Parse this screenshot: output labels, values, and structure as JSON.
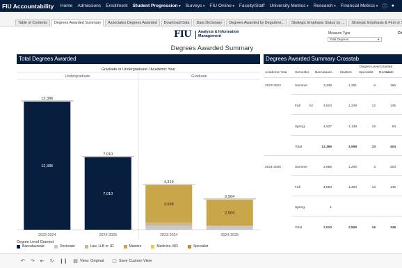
{
  "nav": {
    "brand": "FIU Accountability",
    "items": [
      {
        "label": "Home",
        "active": false,
        "dropdown": false
      },
      {
        "label": "Admissions",
        "active": false,
        "dropdown": false
      },
      {
        "label": "Enrollment",
        "active": false,
        "dropdown": false
      },
      {
        "label": "Student Progression",
        "active": true,
        "dropdown": true
      },
      {
        "label": "Surveys",
        "active": false,
        "dropdown": true
      },
      {
        "label": "FIU Online",
        "active": false,
        "dropdown": true
      },
      {
        "label": "Faculty/Staff",
        "active": false,
        "dropdown": false
      },
      {
        "label": "University Metrics",
        "active": false,
        "dropdown": true
      },
      {
        "label": "Research",
        "active": false,
        "dropdown": true
      },
      {
        "label": "Financial Metrics",
        "active": false,
        "dropdown": true
      }
    ],
    "caret": "▾",
    "help_icon": "help-circle-icon",
    "user_icon": "user-icon"
  },
  "tabs": [
    "Table of Contents",
    "Degrees Awarded Summary",
    "Associates Degrees Awarded",
    "Download Data",
    "Data Dictionary",
    "Degrees Awarded by Departme...",
    "Strategic Emphasis Status by ...",
    "Strategic Emphasis & First or Se..."
  ],
  "active_tab": 1,
  "header": {
    "logo_text": "FIU",
    "logo_sub1": "Analysis & Information",
    "logo_sub2": "Management",
    "title": "Degrees Awarded Summary",
    "measure_label": "Measure Type",
    "measure_value": "Total Degrees",
    "ch_label": "Ch"
  },
  "left_panel": {
    "title": "Total Degrees Awarded"
  },
  "chart_data": {
    "type": "bar",
    "stacked": true,
    "column_header": "Graduate or Undergraduate / Academic Year",
    "groups": [
      "Undergraduate",
      "Graduate"
    ],
    "categories": [
      "2023-2024",
      "2024-2025",
      "2023-2024",
      "2024-2025"
    ],
    "category_group": [
      "Undergraduate",
      "Undergraduate",
      "Graduate",
      "Graduate"
    ],
    "series": [
      {
        "name": "Baccalaureate",
        "color": "#081e3f",
        "values": [
          12386,
          7010,
          0,
          0
        ]
      },
      {
        "name": "Doctorate",
        "color": "#c8c8c8",
        "values": [
          0,
          0,
          404,
          348
        ]
      },
      {
        "name": "Law, LLB or JD",
        "color": "#cbb98a",
        "values": [
          0,
          0,
          284,
          31
        ]
      },
      {
        "name": "Masters",
        "color": "#c9a64a",
        "values": [
          0,
          0,
          3598,
          2509
        ]
      },
      {
        "name": "Medicine, MD",
        "color": "#f0cc38",
        "values": [
          0,
          0,
          0,
          0
        ]
      },
      {
        "name": "Specialist",
        "color": "#b8902c",
        "values": [
          0,
          0,
          33,
          16
        ]
      }
    ],
    "totals": [
      12386,
      7010,
      4319,
      2904
    ],
    "segment_labels": [
      {
        "bar": 0,
        "series": "Baccalaureate",
        "label": "12,386"
      },
      {
        "bar": 1,
        "series": "Baccalaureate",
        "label": "7,010"
      },
      {
        "bar": 2,
        "series": "Masters",
        "label": "3,598"
      },
      {
        "bar": 3,
        "series": "Masters",
        "label": "2,509"
      }
    ],
    "total_labels": [
      "12,386",
      "7,010",
      "4,319",
      "2,904"
    ],
    "ylim": [
      0,
      14000
    ],
    "grid": false,
    "legend_title": "Degree Level Granted",
    "legend_position": "bottom"
  },
  "crosstab": {
    "title": "Degrees Awarded Summary Crosstab",
    "group_header": "Degree Level Granted",
    "columns": [
      "Academic Year",
      "Semester",
      "Baccalaure..",
      "Masters",
      "Specialist",
      "Doctorate",
      "La"
    ],
    "flag_text": "k2",
    "rows": [
      {
        "year": "2023-2024",
        "semester": "Summer",
        "values": [
          "3,335",
          "1,201",
          "6",
          "196"
        ]
      },
      {
        "year": "",
        "semester": "Fall",
        "values": [
          "4,524",
          "1,248",
          "12",
          "145"
        ],
        "flag": true
      },
      {
        "year": "",
        "semester": "Spring",
        "values": [
          "4,527",
          "1,149",
          "15",
          "63"
        ]
      },
      {
        "year": "",
        "semester": "Total",
        "values": [
          "12,386",
          "3,598",
          "33",
          "404"
        ]
      },
      {
        "year": "2024-2025",
        "semester": "Summer",
        "values": [
          "2,956",
          "1,206",
          "3",
          "203"
        ]
      },
      {
        "year": "",
        "semester": "Fall",
        "values": [
          "4,053",
          "1,303",
          "13",
          "145"
        ]
      },
      {
        "year": "",
        "semester": "Spring",
        "values": [
          "1",
          "",
          "",
          ""
        ]
      },
      {
        "year": "",
        "semester": "Total",
        "values": [
          "7,010",
          "2,509",
          "16",
          "348"
        ]
      }
    ]
  },
  "toolbar": {
    "view_original": "View: Original",
    "save_custom": "Save Custom View"
  }
}
